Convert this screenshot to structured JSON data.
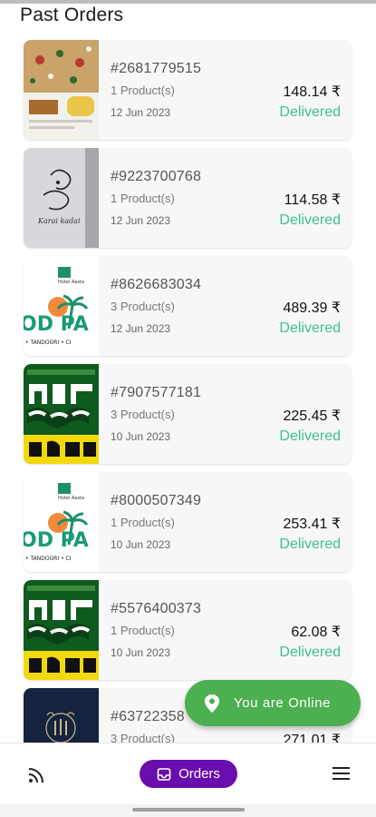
{
  "header": {
    "title": "Past Orders"
  },
  "orders": [
    {
      "id": "#2681779515",
      "products": "1 Product(s)",
      "date": "12 Jun 2023",
      "price": "148.14 ₹",
      "status": "Delivered"
    },
    {
      "id": "#9223700768",
      "products": "1 Product(s)",
      "date": "12 Jun 2023",
      "price": "114.58 ₹",
      "status": "Delivered",
      "thumb_caption": "Karai kadai"
    },
    {
      "id": "#8626683034",
      "products": "3 Product(s)",
      "date": "12 Jun 2023",
      "price": "489.39 ₹",
      "status": "Delivered",
      "thumb_text": {
        "top": "Hotel Aasta",
        "big": "OD PA",
        "bottom": "• TANDOORI • CI"
      }
    },
    {
      "id": "#7907577181",
      "products": "3 Product(s)",
      "date": "10 Jun 2023",
      "price": "225.45 ₹",
      "status": "Delivered"
    },
    {
      "id": "#8000507349",
      "products": "1 Product(s)",
      "date": "10 Jun 2023",
      "price": "253.41 ₹",
      "status": "Delivered",
      "thumb_text": {
        "top": "Hotel Aasta",
        "big": "OD PA",
        "bottom": "• TANDOORI • CI"
      }
    },
    {
      "id": "#5576400373",
      "products": "1 Product(s)",
      "date": "10 Jun 2023",
      "price": "62.08 ₹",
      "status": "Delivered"
    },
    {
      "id": "#63722358",
      "products": "3 Product(s)",
      "date": "",
      "price": "271.01 ₹",
      "status": ""
    }
  ],
  "fab": {
    "label": "You are Online",
    "icon": "location-pin-icon",
    "color": "#4caf50"
  },
  "bottom_nav": {
    "feed_icon": "rss-feed-icon",
    "orders_label": "Orders",
    "orders_icon": "inbox-icon",
    "menu_icon": "hamburger-menu-icon",
    "active_color": "#6a0dad"
  },
  "colors": {
    "delivered": "#3cc08f"
  }
}
